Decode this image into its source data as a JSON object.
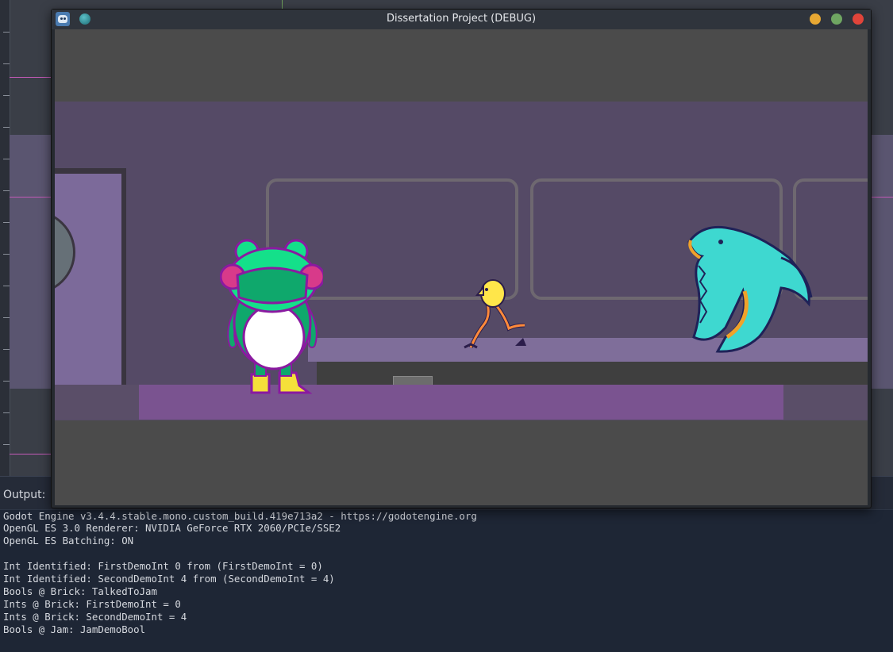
{
  "window": {
    "title": "Dissertation Project (DEBUG)",
    "icon": "godot-icon",
    "controls": [
      "minimize-button",
      "maximize-button",
      "close-button"
    ],
    "colors": {
      "minimize": "#e8a833",
      "maximize": "#6fa662",
      "close": "#e0443a"
    }
  },
  "game": {
    "characters": [
      "frog-character",
      "yellow-bird-character",
      "cyan-shark-character"
    ]
  },
  "output": {
    "label": "Output:",
    "lines": [
      "Godot Engine v3.4.4.stable.mono.custom_build.419e713a2 - https://godotengine.org",
      "OpenGL ES 3.0 Renderer: NVIDIA GeForce RTX 2060/PCIe/SSE2",
      "OpenGL ES Batching: ON",
      "",
      "Int Identified: FirstDemoInt 0 from (FirstDemoInt = 0)",
      "Int Identified: SecondDemoInt 4 from (SecondDemoInt = 4)",
      "Bools @ Brick: TalkedToJam",
      "Ints @ Brick: FirstDemoInt = 0",
      "Ints @ Brick: SecondDemoInt = 4",
      "Bools @ Jam: JamDemoBool"
    ]
  }
}
